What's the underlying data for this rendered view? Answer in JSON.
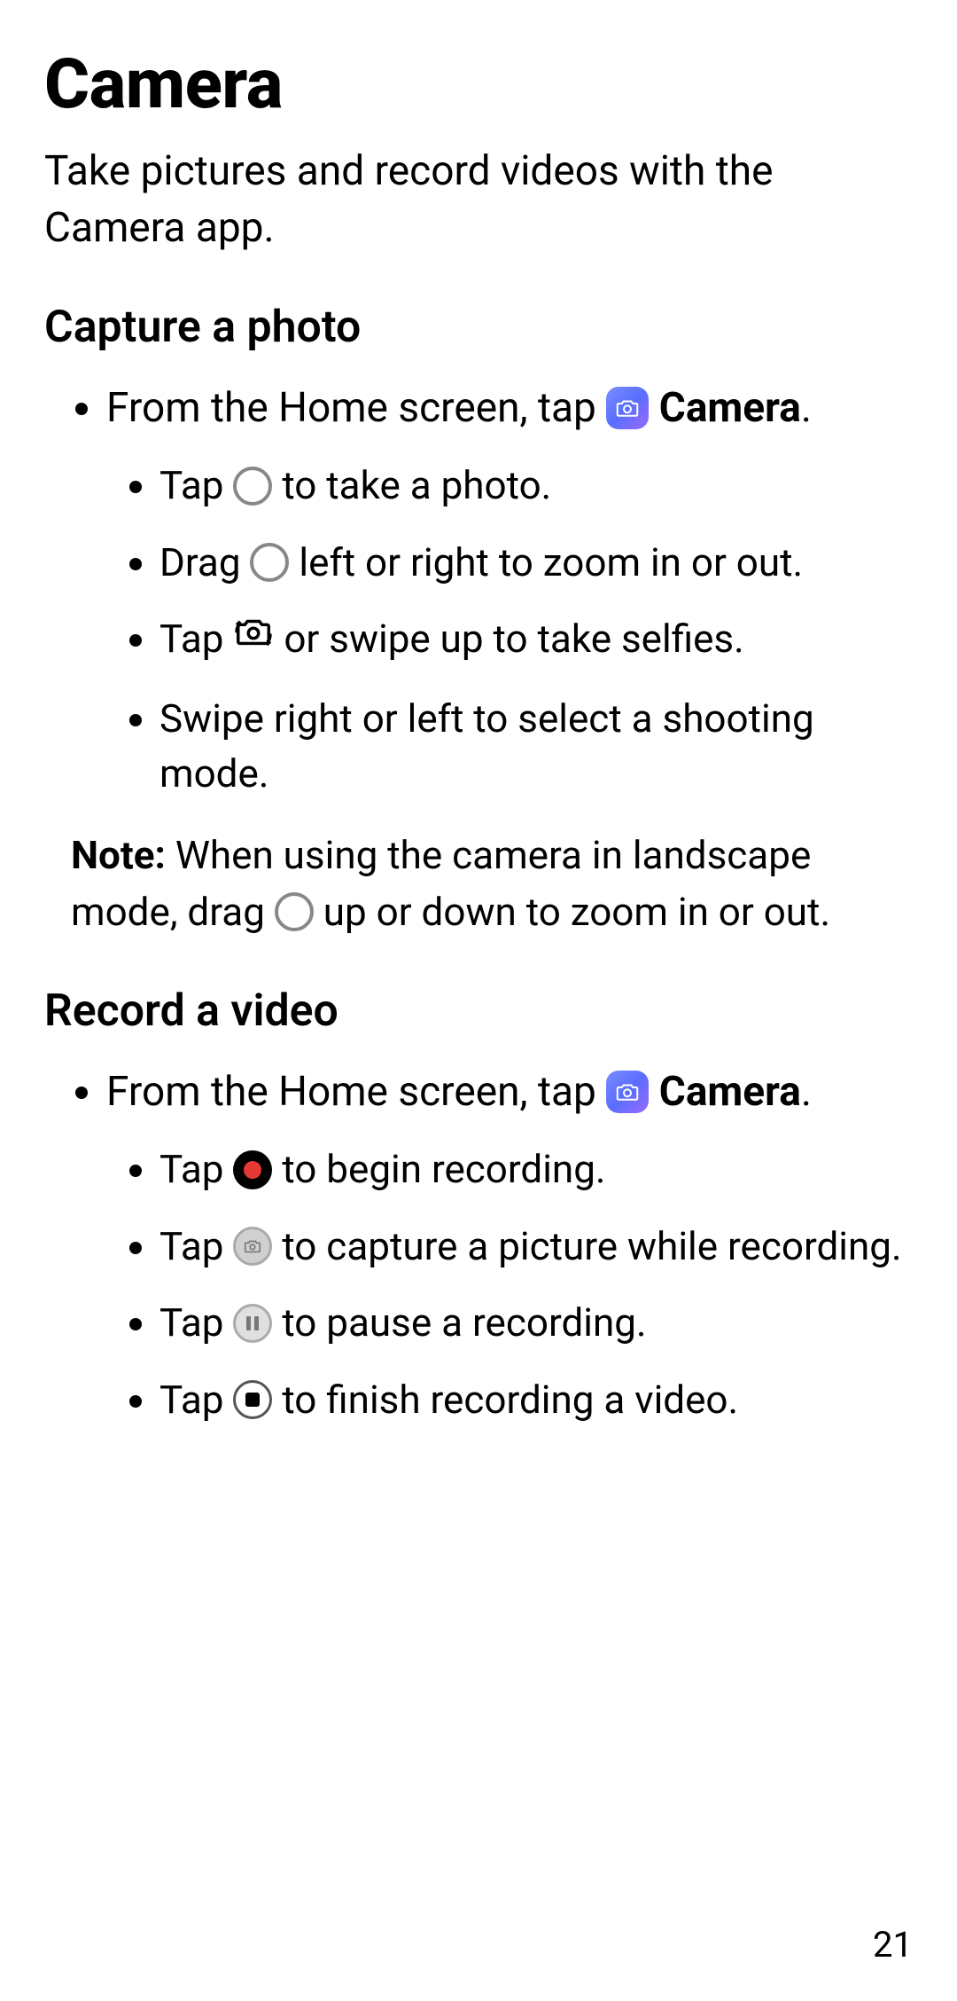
{
  "title": "Camera",
  "intro": "Take pictures and record videos with the Camera app.",
  "section1": {
    "heading": "Capture a photo",
    "item_prefix": "From the Home screen, tap ",
    "item_bold": "Camera",
    "item_suffix": ".",
    "sub1_a": "Tap ",
    "sub1_b": " to take a photo.",
    "sub2_a": "Drag ",
    "sub2_b": " left or right to zoom in or out.",
    "sub3_a": "Tap ",
    "sub3_b": " or swipe up to take selfies.",
    "sub4": "Swipe right or left to select a shooting mode."
  },
  "note": {
    "label": "Note:",
    "part1": " When using the camera in landscape mode, drag ",
    "part2": " up or down to zoom in or out."
  },
  "section2": {
    "heading": "Record a video",
    "item_prefix": "From the Home screen, tap ",
    "item_bold": "Camera",
    "item_suffix": ".",
    "sub1_a": "Tap ",
    "sub1_b": " to begin recording.",
    "sub2_a": "Tap ",
    "sub2_b": " to capture a picture while recording.",
    "sub3_a": "Tap ",
    "sub3_b": " to pause a recording.",
    "sub4_a": "Tap ",
    "sub4_b": " to finish recording a video."
  },
  "page_number": "21"
}
